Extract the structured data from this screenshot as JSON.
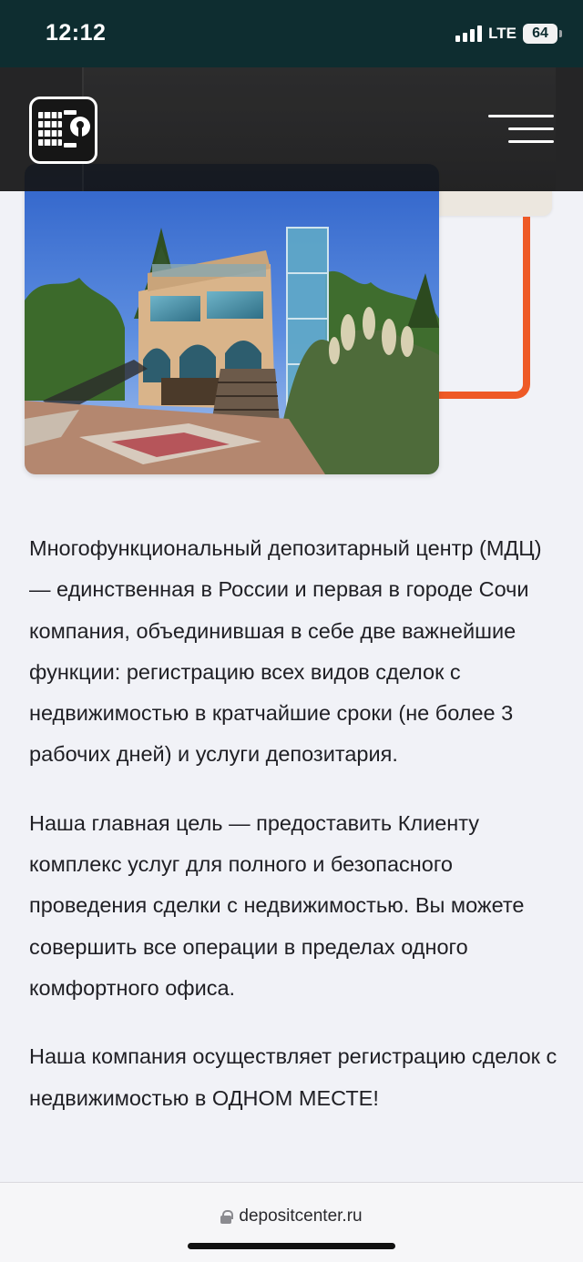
{
  "status_bar": {
    "time": "12:12",
    "network": "LTE",
    "battery": "64"
  },
  "header": {
    "logo_icon": "depositcenter-logo",
    "menu_icon": "hamburger-menu-icon"
  },
  "hero": {
    "photo_icon": "building-photo",
    "accent_color": "#ee5a26"
  },
  "content": {
    "paragraphs": [
      "Многофункциональный депозитарный центр (МДЦ) — единственная в России и первая в городе Сочи компания, объединившая в себе две важнейшие функции: регистрацию всех видов сделок с недвижимостью в кратчайшие сроки (не более 3 рабочих дней) и услуги депозитария.",
      "Наша главная цель — предоставить Клиенту комплекс услуг для полного и безопасного проведения сделки с недвижимостью. Вы можете совершить все операции в пределах одного комфортного офиса.",
      "Наша компания осуществляет регистрацию сделок с недвижимостью в ОДНОМ МЕСТЕ!"
    ]
  },
  "browser": {
    "url": "depositcenter.ru",
    "lock_icon": "lock-icon"
  }
}
